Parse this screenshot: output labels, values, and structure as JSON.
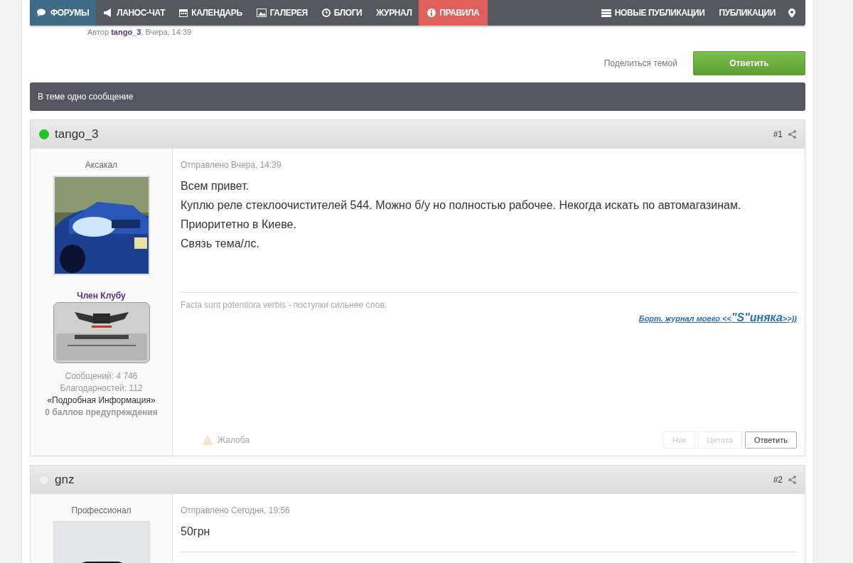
{
  "nav": {
    "items": [
      {
        "label": "ФОРУМЫ",
        "kind": "normal",
        "selected": true
      },
      {
        "label": "ЛАНОС-ЧАТ",
        "kind": "normal",
        "selected": false
      },
      {
        "label": "КАЛЕНДАРЬ",
        "kind": "normal",
        "selected": false
      },
      {
        "label": "ГАЛЕРЕЯ",
        "kind": "normal",
        "selected": false
      },
      {
        "label": "БЛОГИ",
        "kind": "normal",
        "selected": false
      },
      {
        "label": "ЖУРНАЛ",
        "kind": "normal",
        "selected": false
      },
      {
        "label": "ПРАВИЛА",
        "kind": "alert",
        "selected": false
      }
    ],
    "right_items": [
      {
        "label": "НОВЫЕ ПУБЛИКАЦИИ"
      },
      {
        "label": "ПУБЛИКАЦИИ"
      }
    ]
  },
  "topic": {
    "author_prefix": "Автор",
    "author": "tango_3",
    "date": ", Вчера, 14:39"
  },
  "actions": {
    "share": "Поделиться темой",
    "reply": "Ответить"
  },
  "summary": "В теме одно сообщение",
  "posts": [
    {
      "username": "tango_3",
      "online": true,
      "number": "#1",
      "rank": "Аксакал",
      "group": "Член Клубу",
      "stats": [
        "Сообщений: 4 746",
        "Благодарностей: 112"
      ],
      "profile_link": "«Подробная Информация»",
      "warnings": "0 баллов предупреждения",
      "date": "Отправлено Вчера, 14:39",
      "paragraphs": [
        "Всем привет.",
        "Куплю реле стеклоочистителей 544. Можно б/у но полностью рабочее. Некогда искать по автомагазинам.",
        "Приоритетно в Киеве.",
        "Связь тема/лс."
      ],
      "signature": {
        "text": "Facta sunt potentiora verbis - поступки сильнее слов.",
        "link_parts": [
          "Борт. журнал моего <<",
          "\"S\"иняка",
          ">>))"
        ]
      },
      "report": "Жалоба",
      "buttons": [
        {
          "label": "Ник",
          "disabled": true
        },
        {
          "label": "Цитата",
          "disabled": true
        },
        {
          "label": "Ответить",
          "disabled": false
        }
      ]
    },
    {
      "username": "gnz",
      "online": false,
      "number": "#2",
      "rank": "Профессионал",
      "date": "Отправлено Сегодня, 19:56",
      "paragraphs": [
        "50грн"
      ]
    }
  ]
}
